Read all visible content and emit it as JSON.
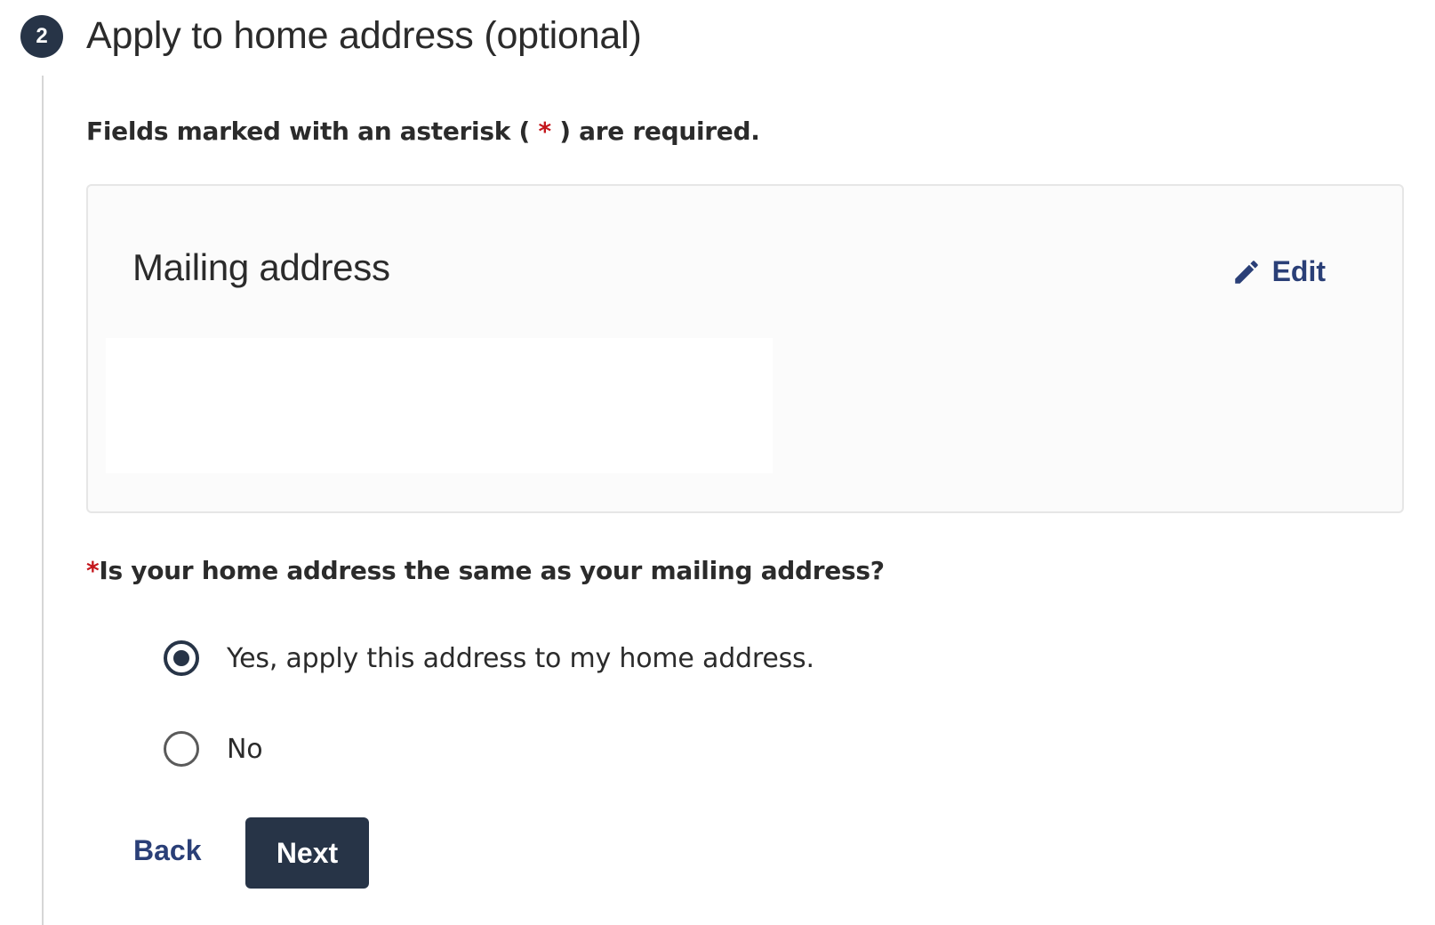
{
  "step": {
    "number": "2",
    "title": "Apply to home address (optional)"
  },
  "required_note": {
    "prefix": "Fields marked with an asterisk ( ",
    "asterisk": "*",
    "suffix": " ) are required."
  },
  "mailing_card": {
    "title": "Mailing address",
    "edit_label": "Edit",
    "edit_icon": "pencil-icon"
  },
  "question": {
    "asterisk": "*",
    "text": "Is your home address the same as your mailing address?"
  },
  "options": {
    "yes": {
      "label": "Yes, apply this address to my home address.",
      "selected": true
    },
    "no": {
      "label": "No",
      "selected": false
    }
  },
  "actions": {
    "back_label": "Back",
    "next_label": "Next"
  },
  "colors": {
    "primary": "#273447",
    "link": "#2a3f77",
    "required": "#c4161c"
  }
}
